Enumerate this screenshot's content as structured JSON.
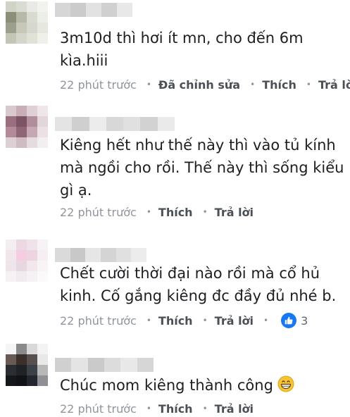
{
  "comments": [
    {
      "text_lines": [
        "3m10d thì hơi ít mn, cho đến 6m",
        "kìa.hiii"
      ],
      "time": "22 phút trước",
      "edited": "Đã chỉnh sửa",
      "like": "Thích",
      "reply": "Trả lời"
    },
    {
      "text_lines": [
        "Kiêng hết như thế này thì vào tủ kính",
        "mà ngồi cho rồi. Thế này thì sống kiểu",
        "gì ạ."
      ],
      "time": "22 phút trước",
      "like": "Thích",
      "reply": "Trả lời"
    },
    {
      "text_lines": [
        "Chết cười  thời đại nào rồi mà cổ hủ",
        "kinh. Cố gắng kiêng đc đầy đủ nhé b."
      ],
      "time": "22 phút trước",
      "like": "Thích",
      "reply": "Trả lời",
      "reaction_icon": "like-thumbs-up-icon",
      "reaction_count": "3"
    },
    {
      "text_lines": [
        "Chúc mom kiêng thành công"
      ],
      "time": "22 phút trước",
      "like": "Thích",
      "reply": "Trả lời",
      "emoji_icon": "grinning-face-emoji-icon"
    }
  ],
  "colors": {
    "text": "#1c1e21",
    "meta": "#90949c",
    "link": "#4b4f56",
    "like_blue": "#1877f2",
    "emoji_yellow": "#f7c531"
  }
}
